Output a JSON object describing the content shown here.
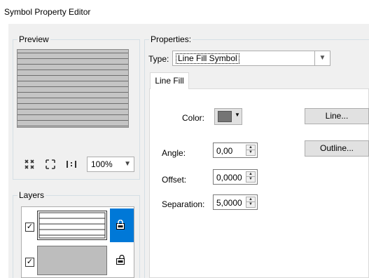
{
  "window": {
    "title": "Symbol Property Editor"
  },
  "preview": {
    "label": "Preview",
    "zoom": {
      "value": "100%",
      "options": [
        "100%"
      ]
    },
    "tools": [
      {
        "name": "zoom-in-icon",
        "glyph": "⛶"
      },
      {
        "name": "zoom-out-icon",
        "glyph": "⤡"
      },
      {
        "name": "actual-size-icon",
        "glyph": "1:1"
      }
    ]
  },
  "layers": {
    "label": "Layers",
    "items": [
      {
        "checked": true,
        "selected": true,
        "kind": "line-fill"
      },
      {
        "checked": true,
        "selected": false,
        "kind": "solid-fill"
      }
    ]
  },
  "properties": {
    "label": "Properties:",
    "type_label": "Type:",
    "type_value": "Line Fill Symbol",
    "tabs": [
      {
        "label": "Line Fill"
      }
    ],
    "color_label": "Color:",
    "color_value": "#757575",
    "angle_label": "Angle:",
    "angle_value": "0,00",
    "offset_label": "Offset:",
    "offset_value": "0,0000",
    "separation_label": "Separation:",
    "separation_value": "5,0000",
    "line_button": "Line...",
    "outline_button": "Outline..."
  },
  "colors": {
    "selection_blue": "#0078d7",
    "preview_fill": "#c4c4c4",
    "preview_lines": "#6e6e6e"
  }
}
